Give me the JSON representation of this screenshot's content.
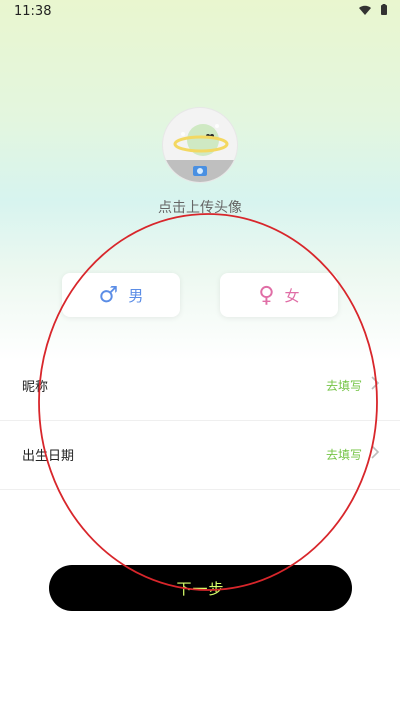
{
  "status": {
    "time": "11:38"
  },
  "avatar": {
    "label": "点击上传头像"
  },
  "gender": {
    "male_label": "男",
    "female_label": "女",
    "male_symbol": "♂",
    "female_symbol": "♀"
  },
  "form": {
    "nickname_label": "昵称",
    "nickname_action": "去填写",
    "birth_label": "出生日期",
    "birth_action": "去填写"
  },
  "actions": {
    "next_label": "下一步"
  },
  "colors": {
    "accent": "#74c445",
    "male": "#5b8de6",
    "female": "#e06ea6",
    "button": "#000000",
    "button_text": "#d7ff6a"
  },
  "icons": [
    "wifi-icon",
    "battery-icon",
    "camera-icon",
    "male-icon",
    "female-icon",
    "chevron-right-icon"
  ]
}
